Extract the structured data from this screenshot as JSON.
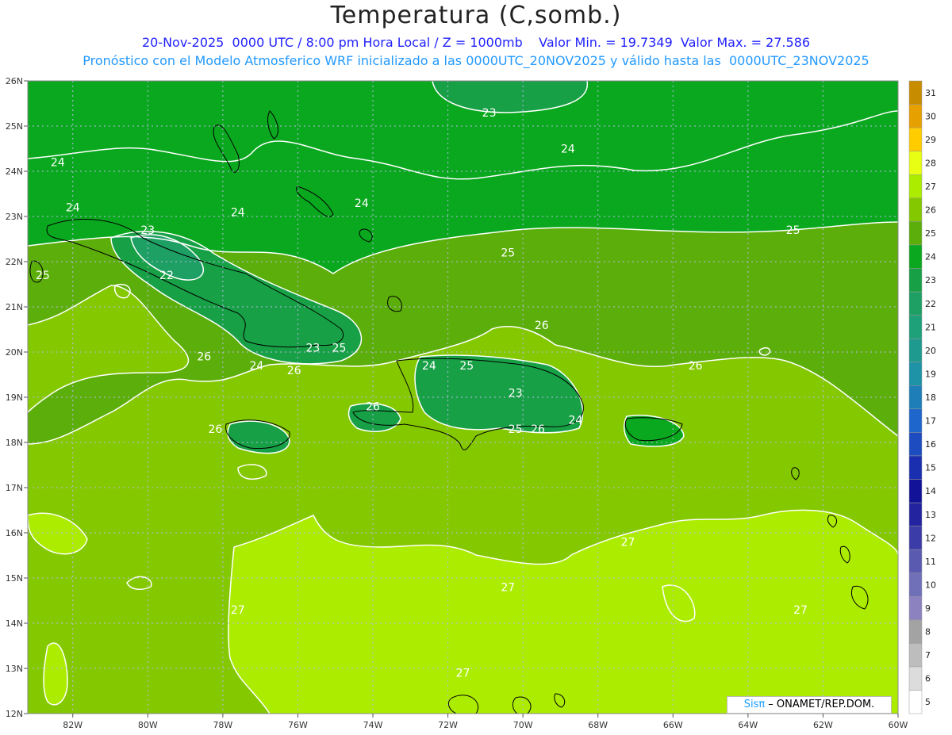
{
  "header": {
    "title": "Temperatura (C,somb.)",
    "subtitle1": "20-Nov-2025  0000 UTC / 8:00 pm Hora Local / Z = 1000mb    Valor Min. = 19.7349  Valor Max. = 27.586",
    "subtitle2": "Pronóstico con el Modelo Atmosferico WRF inicializado a las 0000UTC_20NOV2025 y válido hasta las  0000UTC_23NOV2025"
  },
  "map": {
    "lat_labels": [
      "26N",
      "25N",
      "24N",
      "23N",
      "22N",
      "21N",
      "20N",
      "19N",
      "18N",
      "17N",
      "16N",
      "15N",
      "14N",
      "13N",
      "12N"
    ],
    "lon_labels": [
      "82W",
      "80W",
      "78W",
      "76W",
      "74W",
      "72W",
      "70W",
      "68W",
      "66W",
      "64W",
      "62W",
      "60W"
    ],
    "lat_range": [
      12,
      26
    ],
    "lon_range": [
      -83.2,
      -60
    ],
    "grid": true,
    "contour_labels": [
      {
        "text": "23",
        "lon": -70.9,
        "lat": 25.3
      },
      {
        "text": "24",
        "lon": -68.8,
        "lat": 24.5
      },
      {
        "text": "24",
        "lon": -82.4,
        "lat": 24.2
      },
      {
        "text": "24",
        "lon": -82.0,
        "lat": 23.2
      },
      {
        "text": "24",
        "lon": -77.6,
        "lat": 23.1
      },
      {
        "text": "24",
        "lon": -74.3,
        "lat": 23.3
      },
      {
        "text": "25",
        "lon": -62.8,
        "lat": 22.7
      },
      {
        "text": "25",
        "lon": -70.4,
        "lat": 22.2
      },
      {
        "text": "25",
        "lon": -82.8,
        "lat": 21.7
      },
      {
        "text": "23",
        "lon": -80.0,
        "lat": 22.7
      },
      {
        "text": "22",
        "lon": -79.5,
        "lat": 21.7
      },
      {
        "text": "26",
        "lon": -69.5,
        "lat": 20.6
      },
      {
        "text": "26",
        "lon": -78.5,
        "lat": 19.9
      },
      {
        "text": "25",
        "lon": -74.9,
        "lat": 20.1
      },
      {
        "text": "23",
        "lon": -75.6,
        "lat": 20.1
      },
      {
        "text": "24",
        "lon": -77.1,
        "lat": 19.7
      },
      {
        "text": "26",
        "lon": -76.1,
        "lat": 19.6
      },
      {
        "text": "24",
        "lon": -72.5,
        "lat": 19.7
      },
      {
        "text": "25",
        "lon": -71.5,
        "lat": 19.7
      },
      {
        "text": "26",
        "lon": -65.4,
        "lat": 19.7
      },
      {
        "text": "23",
        "lon": -70.2,
        "lat": 19.1
      },
      {
        "text": "26",
        "lon": -74.0,
        "lat": 18.8
      },
      {
        "text": "26",
        "lon": -78.2,
        "lat": 18.3
      },
      {
        "text": "25",
        "lon": -70.2,
        "lat": 18.3
      },
      {
        "text": "26",
        "lon": -69.6,
        "lat": 18.3
      },
      {
        "text": "24",
        "lon": -68.6,
        "lat": 18.5
      },
      {
        "text": "27",
        "lon": -67.2,
        "lat": 15.8
      },
      {
        "text": "27",
        "lon": -70.4,
        "lat": 14.8
      },
      {
        "text": "27",
        "lon": -62.6,
        "lat": 14.3
      },
      {
        "text": "27",
        "lon": -77.6,
        "lat": 14.3
      },
      {
        "text": "27",
        "lon": -71.6,
        "lat": 12.9
      }
    ]
  },
  "colorbar": {
    "labels": [
      "5",
      "6",
      "7",
      "8",
      "9",
      "10",
      "11",
      "12",
      "13",
      "14",
      "15",
      "16",
      "17",
      "18",
      "19",
      "20",
      "21",
      "22",
      "23",
      "24",
      "25",
      "26",
      "27",
      "28",
      "29",
      "30",
      "31"
    ],
    "colors": [
      "#ffffff",
      "#dcdcdc",
      "#bdbdbd",
      "#a3a3a3",
      "#8c82c0",
      "#7070b8",
      "#5a5ab0",
      "#3c3ca8",
      "#2323a0",
      "#121299",
      "#1a2fb0",
      "#1d4cc0",
      "#1e66cc",
      "#1e7fb8",
      "#1e92a6",
      "#1e9a8e",
      "#1ea078",
      "#1ea064",
      "#17a045",
      "#0aa81e",
      "#5cae0a",
      "#84c800",
      "#acec00",
      "#e8ff14",
      "#ffcc00",
      "#e6a000",
      "#c88c00"
    ]
  },
  "credit": {
    "brand": "Sisπ",
    "text": " – ONAMET/REP.DOM."
  }
}
